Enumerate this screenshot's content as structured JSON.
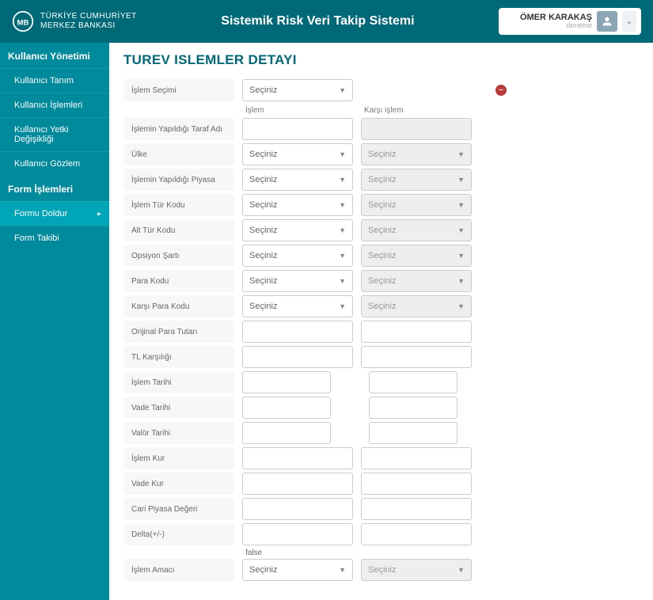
{
  "header": {
    "org_line1": "TÜRKİYE CUMHURİYET",
    "org_line2": "MERKEZ BANKASI",
    "title": "Sistemik Risk Veri Takip Sistemi",
    "user_name": "ÖMER KARAKAŞ",
    "user_sub": "deneme"
  },
  "sidebar": {
    "section1_title": "Kullanıcı Yönetimi",
    "section1_items": [
      "Kullanıcı Tanım",
      "Kullanıcı İşlemleri",
      "Kullanıcı Yetki Değişikliği",
      "Kullanıcı Gözlem"
    ],
    "section2_title": "Form İşlemleri",
    "section2_items": [
      "Formu Doldur",
      "Form Takibi"
    ],
    "active_index": 0
  },
  "page": {
    "title": "TUREV ISLEMLER DETAYI",
    "select_placeholder": "Seçiniz",
    "col_islem": "İşlem",
    "col_karsi": "Karşı işlem",
    "false_note": "false",
    "labels": {
      "islem_secimi": "İşlem Seçimi",
      "tarafi": "İşlemin Yapıldığı Taraf Adı",
      "ulke": "Ülke",
      "piyasa": "İşlemin Yapıldığı Piyasa",
      "tur_kodu": "İşlem Tür Kodu",
      "alt_tur_kodu": "Alt Tür Kodu",
      "opsiyon_sarti": "Opsiyon Şartı",
      "para_kodu": "Para Kodu",
      "karsi_para_kodu": "Karşı Para Kodu",
      "orijinal_para_tutari": "Orijinal Para Tutarı",
      "tl_karsiligi": "TL Karşılığı",
      "islem_tarihi": "İşlem Tarihi",
      "vade_tarihi": "Vade Tarihi",
      "valor_tarihi": "Valör Tarihi",
      "islem_kur": "İşlem Kur",
      "vade_kur": "Vade Kur",
      "cari_piyasa": "Cari Piyasa Değeri",
      "delta": "Delta(+/-)",
      "islem_amaci": "İşlem Amacı"
    }
  }
}
